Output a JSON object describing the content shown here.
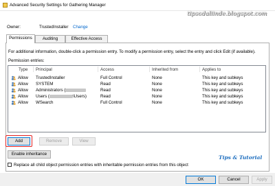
{
  "window": {
    "title": "Advanced Security Settings for Gathering Manager",
    "icon": "folder-lock-icon"
  },
  "watermark_top": "tipsodaliinde.blogspot.com",
  "watermark_bottom": "Tips & Tutorial",
  "owner": {
    "label": "Owner:",
    "value": "TrustedInstaller",
    "change_link": "Change"
  },
  "tabs": [
    {
      "label": "Permissions",
      "active": true
    },
    {
      "label": "Auditing",
      "active": false
    },
    {
      "label": "Effective Access",
      "active": false
    }
  ],
  "info_text": "For additional information, double-click a permission entry. To modify a permission entry, select the entry and click Edit (if available).",
  "entries_label": "Permission entries:",
  "table": {
    "columns": [
      "Type",
      "Principal",
      "Access",
      "Inherited from",
      "Applies to"
    ],
    "rows": [
      {
        "type": "Allow",
        "principal": "TrustedInstaller",
        "access": "Full Control",
        "inherited": "None",
        "applies": "This key and subkeys"
      },
      {
        "type": "Allow",
        "principal": "SYSTEM",
        "access": "Read",
        "inherited": "None",
        "applies": "This key and subkeys"
      },
      {
        "type": "Allow",
        "principal": "Administrators (",
        "principal_suffix": "",
        "access": "Read",
        "inherited": "None",
        "applies": "This key and subkeys"
      },
      {
        "type": "Allow",
        "principal": "Users (",
        "principal_suffix": "\\Users)",
        "access": "Read",
        "inherited": "None",
        "applies": "This key and subkeys"
      },
      {
        "type": "Allow",
        "principal": "WSearch",
        "access": "Full Control",
        "inherited": "None",
        "applies": "This key and subkeys"
      }
    ]
  },
  "buttons": {
    "add": "Add",
    "remove": "Remove",
    "view": "View",
    "enable_inheritance": "Enable inheritance"
  },
  "replace_checkbox": {
    "label": "Replace all child object permission entries with inheritable permission entries from this object",
    "checked": false
  },
  "footer": {
    "ok": "OK",
    "cancel": "Cancel",
    "apply": "Apply"
  },
  "colors": {
    "accent": "#0078d7",
    "highlight_box": "#e02020",
    "link": "#0066cc"
  }
}
